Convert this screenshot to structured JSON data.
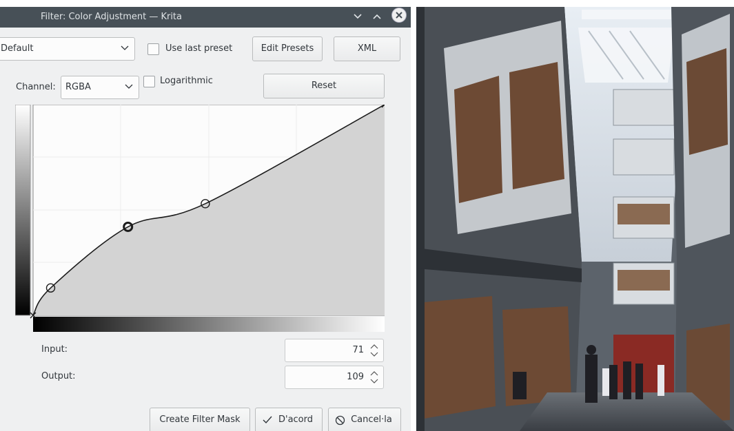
{
  "window": {
    "title": "Filter: Color Adjustment — Krita"
  },
  "preset": {
    "selected": "Default",
    "use_last_label": "Use last preset",
    "use_last_checked": false
  },
  "buttons": {
    "edit_presets": "Edit Presets",
    "xml": "XML",
    "reset": "Reset",
    "create_mask": "Create Filter Mask",
    "ok": "D'acord",
    "cancel": "Cancel·la"
  },
  "channel": {
    "label": "Channel:",
    "selected": "RGBA",
    "logarithmic_label": "Logarithmic",
    "logarithmic_checked": false
  },
  "curve": {
    "points": [
      [
        0,
        0
      ],
      [
        0.05,
        0.13
      ],
      [
        0.27,
        0.42
      ],
      [
        0.49,
        0.53
      ],
      [
        1,
        1
      ]
    ],
    "selected_point": 2
  },
  "fields": {
    "input_label": "Input:",
    "input_value": "71",
    "output_label": "Output:",
    "output_value": "109"
  },
  "colors": {
    "titlebar": "#475057",
    "dialog_bg": "#eff0f1",
    "curve_fill": "#d3d3d3"
  }
}
